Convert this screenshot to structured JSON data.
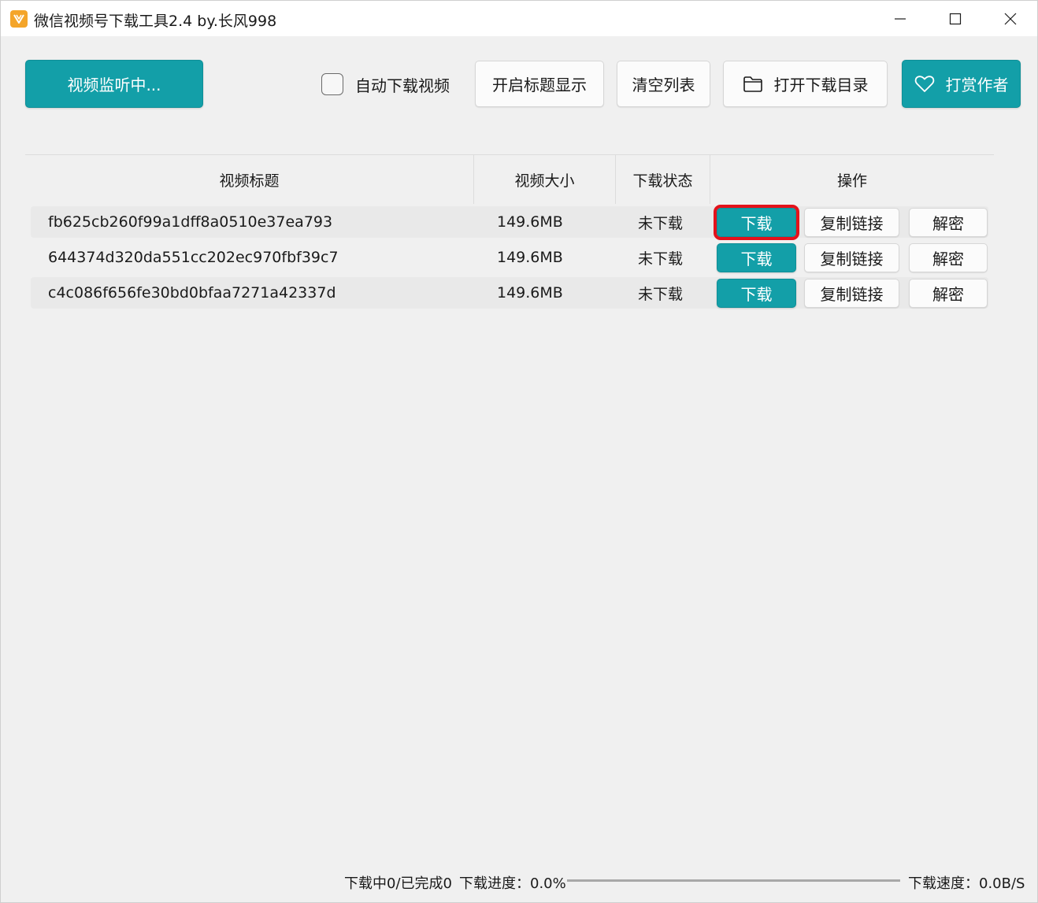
{
  "window": {
    "title": "微信视频号下载工具2.4 by.长风998"
  },
  "toolbar": {
    "monitor_label": "视频监听中...",
    "auto_download_label": "自动下载视频",
    "auto_download_checked": false,
    "title_toggle_label": "开启标题显示",
    "clear_list_label": "清空列表",
    "open_dir_label": "打开下载目录",
    "reward_label": "打赏作者"
  },
  "table": {
    "headers": {
      "title": "视频标题",
      "size": "视频大小",
      "status": "下载状态",
      "actions": "操作"
    },
    "rows": [
      {
        "title": "fb625cb260f99a1dff8a0510e37ea793",
        "size": "149.6MB",
        "status": "未下载",
        "download_label": "下载",
        "copy_label": "复制链接",
        "decrypt_label": "解密"
      },
      {
        "title": "644374d320da551cc202ec970fbf39c7",
        "size": "149.6MB",
        "status": "未下载",
        "download_label": "下载",
        "copy_label": "复制链接",
        "decrypt_label": "解密"
      },
      {
        "title": "c4c086f656fe30bd0bfaa7271a42337d",
        "size": "149.6MB",
        "status": "未下载",
        "download_label": "下载",
        "copy_label": "复制链接",
        "decrypt_label": "解密"
      }
    ]
  },
  "statusbar": {
    "counts": "下载中0/已完成0",
    "progress_text": "下载进度：0.0%",
    "progress_fraction": 0,
    "speed_text": "下载速度：0.0B/S"
  },
  "colors": {
    "accent": "#139fa8",
    "highlight": "#e3121b",
    "app_icon": "#f4a52a"
  },
  "icons": {
    "app": "app-logo-icon",
    "minimize": "minimize-icon",
    "maximize": "maximize-icon",
    "close": "close-icon",
    "folder": "folder-icon",
    "heart": "heart-icon"
  }
}
